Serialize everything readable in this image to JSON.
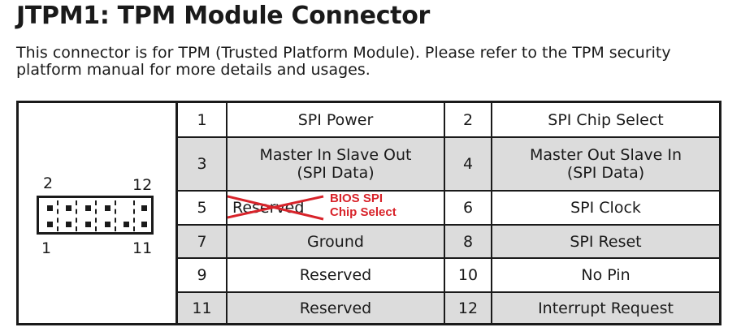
{
  "title": "JTPM1: TPM Module Connector",
  "description": "This connector is for TPM (Trusted Platform Module). Please refer to the TPM security platform manual for more details and usages.",
  "diagram": {
    "label_top_left": "2",
    "label_top_right": "12",
    "label_bottom_left": "1",
    "label_bottom_right": "11"
  },
  "rows": [
    {
      "pin_a": "1",
      "signal_a": "SPI Power",
      "pin_b": "2",
      "signal_b": "SPI Chip Select",
      "shaded": false
    },
    {
      "pin_a": "3",
      "signal_a_line1": "Master In Slave Out",
      "signal_a_line2": "(SPI Data)",
      "pin_b": "4",
      "signal_b_line1": "Master Out Slave In",
      "signal_b_line2": "(SPI Data)",
      "shaded": true
    },
    {
      "pin_a": "5",
      "signal_a_struck": "Reserved",
      "signal_a_annotation_line1": "BIOS SPI",
      "signal_a_annotation_line2": "Chip Select",
      "pin_b": "6",
      "signal_b": "SPI Clock",
      "shaded": false
    },
    {
      "pin_a": "7",
      "signal_a": "Ground",
      "pin_b": "8",
      "signal_b": "SPI Reset",
      "shaded": true
    },
    {
      "pin_a": "9",
      "signal_a": "Reserved",
      "pin_b": "10",
      "signal_b": "No Pin",
      "shaded": false
    },
    {
      "pin_a": "11",
      "signal_a": "Reserved",
      "pin_b": "12",
      "signal_b": "Interrupt Request",
      "shaded": true
    }
  ],
  "colors": {
    "annotation_red": "#d8232a",
    "shaded_row": "#dcdcdc",
    "text": "#1a1a1a"
  }
}
